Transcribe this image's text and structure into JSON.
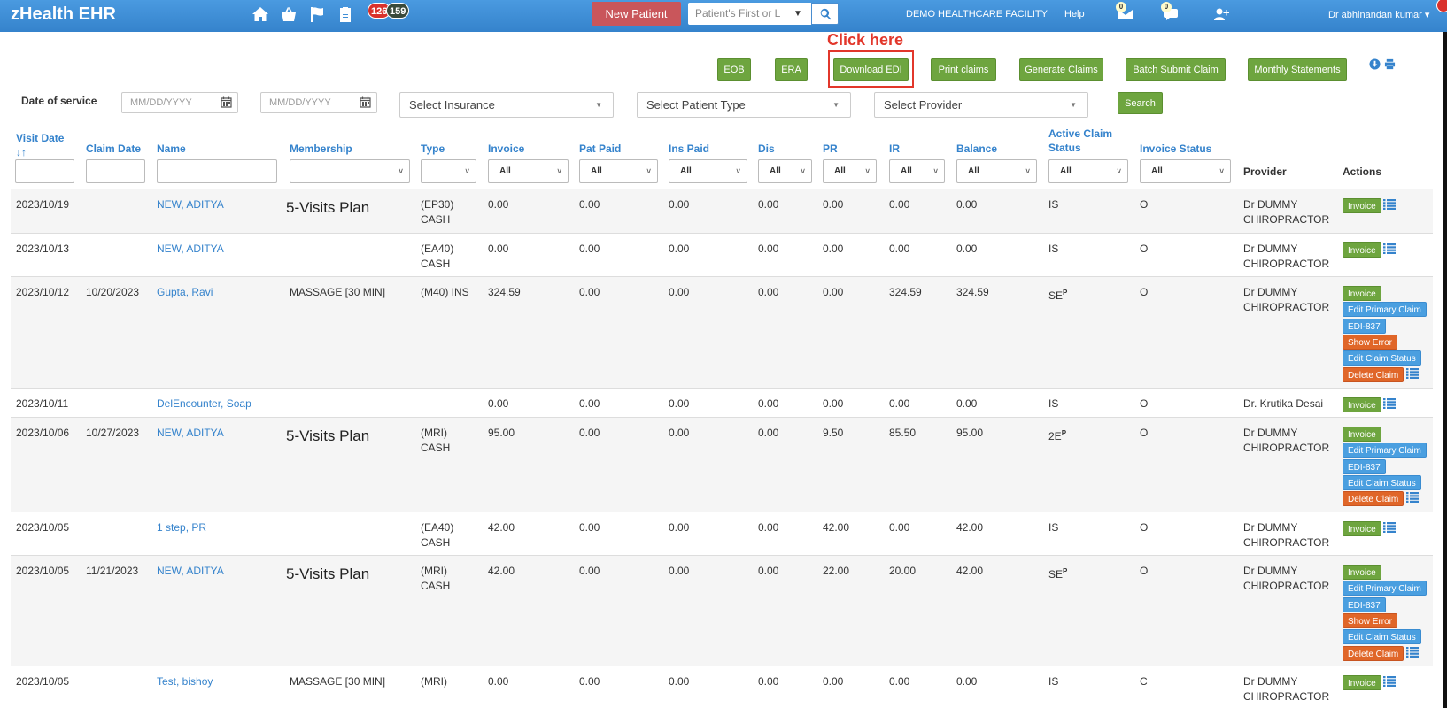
{
  "app": {
    "brand": "zHealth EHR",
    "badge_red": "126",
    "badge_dark": "159",
    "new_patient": "New Patient",
    "search_placeholder": "Patient's First or L",
    "facility": "DEMO HEALTHCARE FACILITY",
    "help": "Help",
    "mail_count": "0",
    "chat_count": "0",
    "user": "Dr abhinandan kumar ▾"
  },
  "annotation": {
    "click_here": "Click here"
  },
  "toolbar": {
    "eob": "EOB",
    "era": "ERA",
    "download_edi": "Download EDI",
    "print_claims": "Print claims",
    "generate_claims": "Generate Claims",
    "batch_submit": "Batch Submit Claim",
    "monthly_statements": "Monthly Statements"
  },
  "filters": {
    "date_label": "Date of service",
    "date_from_placeholder": "MM/DD/YYYY",
    "date_to_placeholder": "MM/DD/YYYY",
    "insurance": "Select Insurance",
    "patient_type": "Select Patient Type",
    "provider": "Select Provider",
    "search": "Search"
  },
  "columns": {
    "visit_date": "Visit Date",
    "sort_arrows": "↓↑",
    "claim_date": "Claim Date",
    "name": "Name",
    "membership": "Membership",
    "type": "Type",
    "invoice": "Invoice",
    "pat_paid": "Pat Paid",
    "ins_paid": "Ins Paid",
    "dis": "Dis",
    "pr": "PR",
    "ir": "IR",
    "balance": "Balance",
    "active_claim_1": "Active Claim",
    "active_claim_2": "Status",
    "invoice_status": "Invoice Status",
    "provider": "Provider",
    "actions": "Actions",
    "all": "All"
  },
  "rows": [
    {
      "visit": "2023/10/19",
      "claim": "",
      "name": "NEW, ADITYA",
      "membership": "5-Visits Plan",
      "type1": "(EP30)",
      "type2": "CASH",
      "invoice": "0.00",
      "pat": "0.00",
      "ins": "0.00",
      "dis": "0.00",
      "pr": "0.00",
      "ir": "0.00",
      "bal": "0.00",
      "status": "IS",
      "sup": "",
      "inv_status": "O",
      "prov1": "Dr DUMMY",
      "prov2": "CHIROPRACTOR"
    },
    {
      "visit": "2023/10/13",
      "claim": "",
      "name": "NEW, ADITYA",
      "membership": "",
      "type1": "(EA40)",
      "type2": "CASH",
      "invoice": "0.00",
      "pat": "0.00",
      "ins": "0.00",
      "dis": "0.00",
      "pr": "0.00",
      "ir": "0.00",
      "bal": "0.00",
      "status": "IS",
      "sup": "",
      "inv_status": "O",
      "prov1": "Dr DUMMY",
      "prov2": "CHIROPRACTOR"
    },
    {
      "visit": "2023/10/12",
      "claim": "10/20/2023",
      "name": "Gupta, Ravi",
      "membership": "MASSAGE [30 MIN]",
      "type1": "(M40) INS",
      "type2": "",
      "invoice": "324.59",
      "pat": "0.00",
      "ins": "0.00",
      "dis": "0.00",
      "pr": "0.00",
      "ir": "324.59",
      "bal": "324.59",
      "status": "SE",
      "sup": "P",
      "inv_status": "O",
      "prov1": "Dr DUMMY",
      "prov2": "CHIROPRACTOR"
    },
    {
      "visit": "2023/10/11",
      "claim": "",
      "name": "DelEncounter, Soap",
      "membership": "",
      "type1": "",
      "type2": "",
      "invoice": "0.00",
      "pat": "0.00",
      "ins": "0.00",
      "dis": "0.00",
      "pr": "0.00",
      "ir": "0.00",
      "bal": "0.00",
      "status": "IS",
      "sup": "",
      "inv_status": "O",
      "prov1": "Dr. Krutika Desai",
      "prov2": ""
    },
    {
      "visit": "2023/10/06",
      "claim": "10/27/2023",
      "name": "NEW, ADITYA",
      "membership": "5-Visits Plan",
      "type1": "(MRI)",
      "type2": "CASH",
      "invoice": "95.00",
      "pat": "0.00",
      "ins": "0.00",
      "dis": "0.00",
      "pr": "9.50",
      "ir": "85.50",
      "bal": "95.00",
      "status": "2E",
      "sup": "P",
      "inv_status": "O",
      "prov1": "Dr DUMMY",
      "prov2": "CHIROPRACTOR"
    },
    {
      "visit": "2023/10/05",
      "claim": "",
      "name": "1 step, PR",
      "membership": "",
      "type1": "(EA40)",
      "type2": "CASH",
      "invoice": "42.00",
      "pat": "0.00",
      "ins": "0.00",
      "dis": "0.00",
      "pr": "42.00",
      "ir": "0.00",
      "bal": "42.00",
      "status": "IS",
      "sup": "",
      "inv_status": "O",
      "prov1": "Dr DUMMY",
      "prov2": "CHIROPRACTOR"
    },
    {
      "visit": "2023/10/05",
      "claim": "11/21/2023",
      "name": "NEW, ADITYA",
      "membership": "5-Visits Plan",
      "type1": "(MRI)",
      "type2": "CASH",
      "invoice": "42.00",
      "pat": "0.00",
      "ins": "0.00",
      "dis": "0.00",
      "pr": "22.00",
      "ir": "20.00",
      "bal": "42.00",
      "status": "SE",
      "sup": "P",
      "inv_status": "O",
      "prov1": "Dr DUMMY",
      "prov2": "CHIROPRACTOR"
    },
    {
      "visit": "2023/10/05",
      "claim": "",
      "name": "Test, bishoy",
      "membership": "MASSAGE [30 MIN]",
      "type1": "(MRI)",
      "type2": "",
      "invoice": "0.00",
      "pat": "0.00",
      "ins": "0.00",
      "dis": "0.00",
      "pr": "0.00",
      "ir": "0.00",
      "bal": "0.00",
      "status": "IS",
      "sup": "",
      "inv_status": "C",
      "prov1": "Dr DUMMY",
      "prov2": "CHIROPRACTOR"
    }
  ],
  "actions": {
    "invoice": "Invoice",
    "edit_primary": "Edit Primary Claim",
    "edi": "EDI-837",
    "show_error": "Show Error",
    "edit_status": "Edit Claim Status",
    "delete_claim": "Delete Claim"
  }
}
